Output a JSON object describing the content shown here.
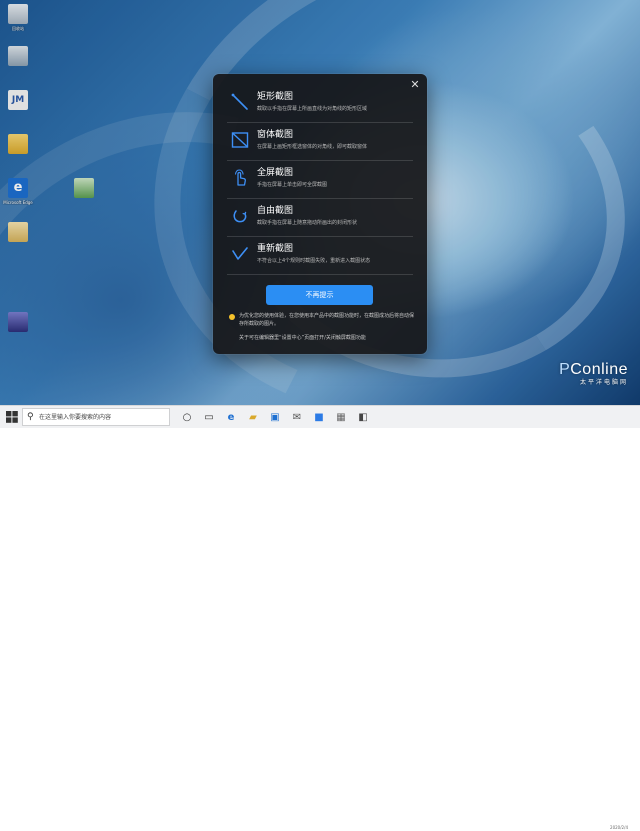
{
  "desktop": {
    "icons": [
      {
        "label": "回收站"
      },
      {
        "label": ""
      },
      {
        "label": ""
      },
      {
        "label": ""
      },
      {
        "label": "Microsoft Edge"
      },
      {
        "label": ""
      },
      {
        "label": ""
      }
    ]
  },
  "dialog": {
    "close_icon": "close-icon",
    "modes": [
      {
        "title": "矩形截图",
        "desc": "截取以手指在屏幕上所画直线为对角线的矩形区域",
        "icon": "rect-capture-icon"
      },
      {
        "title": "窗体截图",
        "desc": "在屏幕上画矩形框选窗体的对角线，即可截取窗体",
        "icon": "window-capture-icon"
      },
      {
        "title": "全屏截图",
        "desc": "手指在屏幕上单击即可全屏截图",
        "icon": "tap-capture-icon"
      },
      {
        "title": "自由截图",
        "desc": "截取手指在屏幕上随意拖动所画出的封闭形状",
        "icon": "free-capture-icon"
      },
      {
        "title": "重新截图",
        "desc": "不符合以上4个规则时截图失败，重新进入截图状态",
        "icon": "retry-capture-icon"
      }
    ],
    "primary_label": "不再提示",
    "tip": "为优化您的使用体验，在您使用本产品中的截图功能时，在截图成功后将自动保存所截取的图片。",
    "note": "关于可在编辑器里“设置中心”页面打开/关闭触屏截图功能",
    "tip_color": "#f5c22b",
    "accent_color": "#2b8ef3"
  },
  "taskbar": {
    "search_placeholder": "在这里输入你要搜索的内容",
    "items": [
      "cortana-icon",
      "task-view-icon",
      "edge-icon",
      "file-explorer-icon",
      "store-icon",
      "mail-icon",
      "app-icon",
      "app-icon",
      "app-icon"
    ]
  },
  "watermark": {
    "brand_p": "P",
    "brand_rest": "Conline",
    "brand_sub": "太平洋电脑网",
    "date": "2020/2/4"
  }
}
